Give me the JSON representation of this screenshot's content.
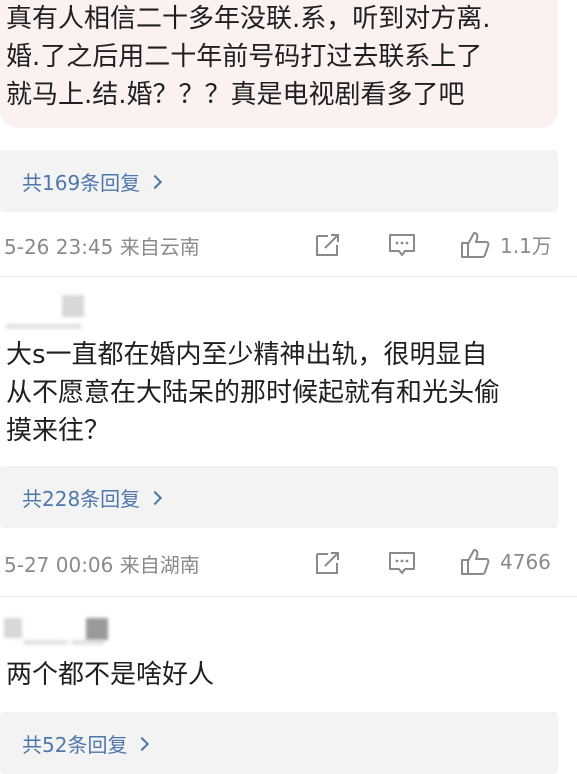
{
  "comments": [
    {
      "text": "真有人相信二十多年没联.系，听到对方离.婚.了之后用二十年前号码打过去联系上了就马上.结.婚？？？真是电视剧看多了吧",
      "lines": [
        "真有人相信二十多年没联.系，听到对方离.",
        "婚.了之后用二十年前号码打过去联系上了",
        "就马上.结.婚？？？真是电视剧看多了吧"
      ],
      "replies_label": "共169条回复",
      "time_location": "5-26 23:45 来自云南",
      "likes": "1.1万"
    },
    {
      "lines": [
        "大s一直都在婚内至少精神出轨，很明显自",
        "从不愿意在大陆呆的那时候起就有和光头偷",
        "摸来往？"
      ],
      "replies_label": "共228条回复",
      "time_location": "5-27 00:06 来自湖南",
      "likes": "4766"
    },
    {
      "lines": [
        "两个都不是啥好人"
      ],
      "replies_label": "共52条回复"
    }
  ],
  "icons": {
    "share": "share-icon",
    "comment": "comment-icon",
    "like": "thumbs-up-icon"
  },
  "colors": {
    "link": "#4e77ab",
    "meta": "#8a8a8a",
    "highlight": "#fbf1f1",
    "reply_box": "#f3f3f3"
  }
}
